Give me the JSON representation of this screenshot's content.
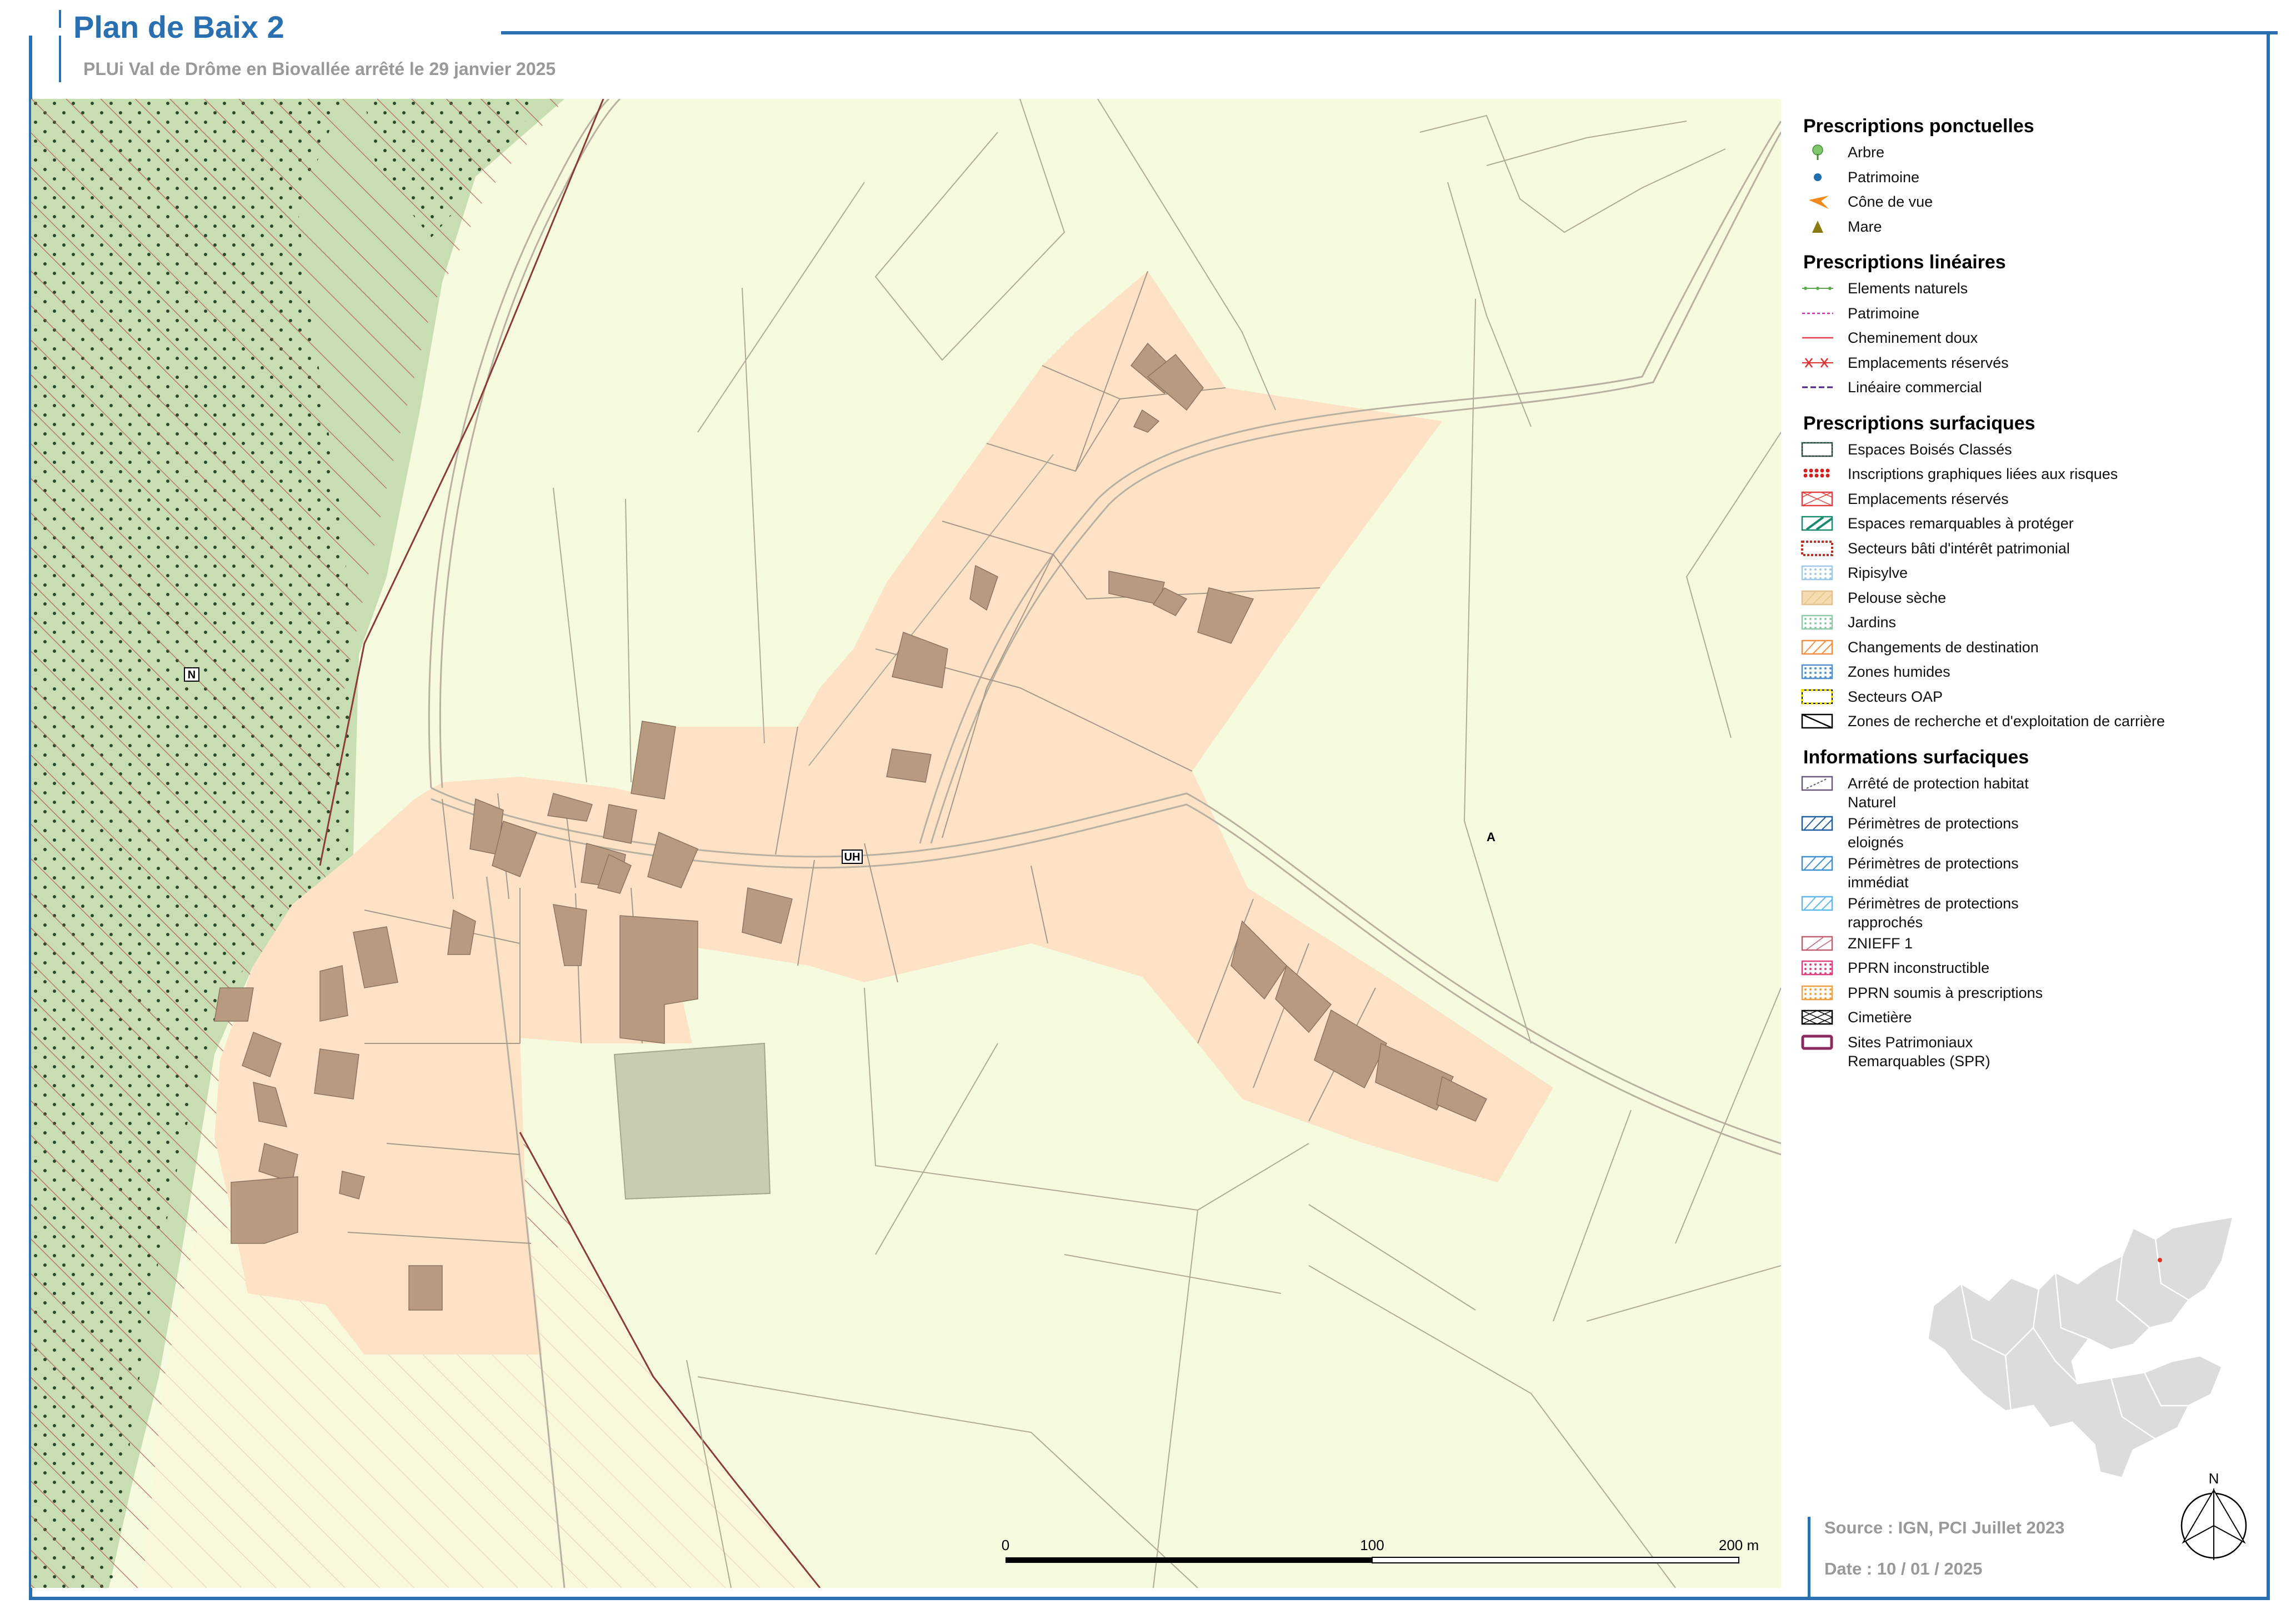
{
  "header": {
    "title": "Plan de Baix 2",
    "subtitle": "PLUi Val de Drôme en Biovallée arrêté le 29 janvier 2025"
  },
  "map": {
    "zone_labels": [
      "N",
      "UH",
      "A"
    ],
    "scale_bar": {
      "ticks": [
        "0",
        "100",
        "200 m"
      ]
    },
    "north_label": "N",
    "colors": {
      "zone_N": "#c9ddb3",
      "zone_A": "#f6fadf",
      "zone_UH": "#fde2c6",
      "building": "#b89a80",
      "pond": "#c6cdb0",
      "hatch_red": "#b0524a",
      "ebc_dot": "#2a4a2a"
    }
  },
  "legend": {
    "sections": [
      {
        "title": "Prescriptions ponctuelles",
        "items": [
          {
            "label": "Arbre",
            "icon": "tree-icon"
          },
          {
            "label": "Patrimoine",
            "icon": "dot-icon"
          },
          {
            "label": "Cône de vue",
            "icon": "cone-icon"
          },
          {
            "label": "Mare",
            "icon": "triangle-icon"
          }
        ]
      },
      {
        "title": "Prescriptions linéaires",
        "items": [
          {
            "label": "Elements naturels",
            "icon": "line-green-dots"
          },
          {
            "label": "Patrimoine",
            "icon": "line-magenta-dash"
          },
          {
            "label": "Cheminement doux",
            "icon": "line-red"
          },
          {
            "label": "Emplacements réservés",
            "icon": "line-red-cross"
          },
          {
            "label": "Linéaire commercial",
            "icon": "line-purple-dash"
          }
        ]
      },
      {
        "title": "Prescriptions surfaciques",
        "items": [
          {
            "label": "Espaces Boisés Classés",
            "icon": "box-ebc"
          },
          {
            "label": "Inscriptions graphiques liées aux risques",
            "icon": "box-red-dots"
          },
          {
            "label": "Emplacements réservés",
            "icon": "box-red-cross"
          },
          {
            "label": "Espaces remarquables à protéger",
            "icon": "box-teal-hatch"
          },
          {
            "label": "Secteurs bâti d'intérêt patrimonial",
            "icon": "box-brown-dash"
          },
          {
            "label": "Ripisylve",
            "icon": "box-blue-dots"
          },
          {
            "label": "Pelouse sèche",
            "icon": "box-tan"
          },
          {
            "label": "Jardins",
            "icon": "box-green-dots"
          },
          {
            "label": "Changements de destination",
            "icon": "box-orange-hatch"
          },
          {
            "label": "Zones humides",
            "icon": "box-blue-dots2"
          },
          {
            "label": "Secteurs OAP",
            "icon": "box-yellow-dash"
          },
          {
            "label": "Zones de recherche et d'exploitation de carrière",
            "icon": "box-black-hatch"
          }
        ]
      },
      {
        "title": "Informations surfaciques",
        "items": [
          {
            "label": "Arrêté de protection habitat Naturel",
            "icon": "box-purple-dash"
          },
          {
            "label": "Périmètres de protections eloignés",
            "icon": "box-blue-hatch"
          },
          {
            "label": "Périmètres de protections immédiat",
            "icon": "box-blue-hatch2"
          },
          {
            "label": "Périmètres de protections rapprochés",
            "icon": "box-cyan-hatch"
          },
          {
            "label": "ZNIEFF 1",
            "icon": "box-rose-hatch"
          },
          {
            "label": "PPRN inconstructible",
            "icon": "box-pink-dots"
          },
          {
            "label": "PPRN soumis à prescriptions",
            "icon": "box-orange-dots"
          },
          {
            "label": "Cimetière",
            "icon": "box-cross"
          },
          {
            "label": "Sites Patrimoniaux Remarquables (SPR)",
            "icon": "box-spr"
          }
        ]
      }
    ]
  },
  "footer": {
    "source": "Source : IGN, PCI Juillet 2023",
    "date": "Date : 10 / 01 / 2025"
  }
}
